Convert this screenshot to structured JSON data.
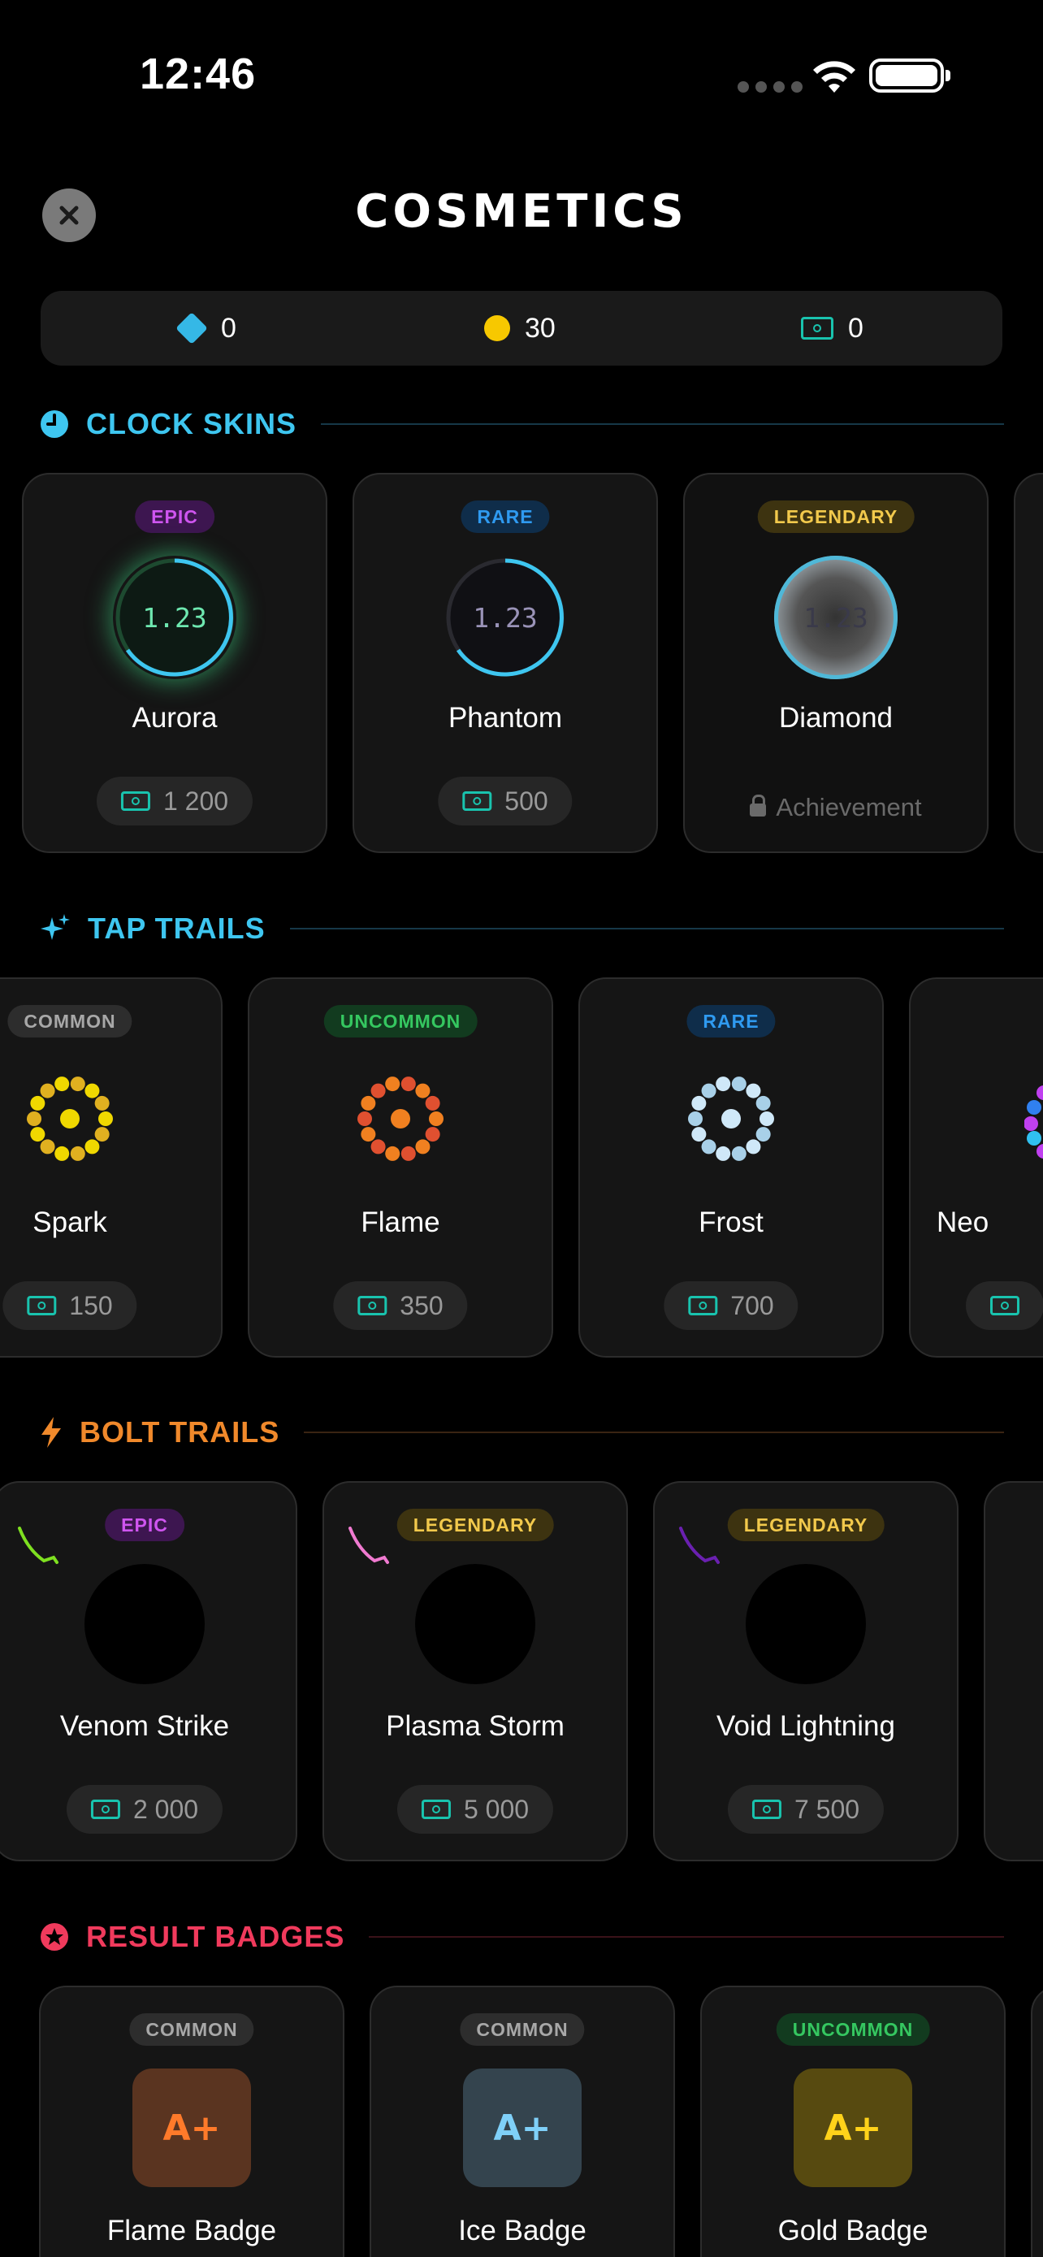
{
  "status": {
    "time": "12:46"
  },
  "title": "COSMETICS",
  "currency": {
    "gems": "0",
    "coins": "30",
    "tickets": "0"
  },
  "sections": {
    "clock_skins": "CLOCK SKINS",
    "tap_trails": "TAP TRAILS",
    "bolt_trails": "BOLT TRAILS",
    "result_badges": "RESULT BADGES"
  },
  "clock_skins": [
    {
      "rarity": "EPIC",
      "preview": "1.23",
      "name": "Aurora",
      "price": "1 200"
    },
    {
      "rarity": "RARE",
      "preview": "1.23",
      "name": "Phantom",
      "price": "500"
    },
    {
      "rarity": "LEGENDARY",
      "preview": "1.23",
      "name": "Diamond",
      "locked_label": "Achievement"
    }
  ],
  "tap_trails": [
    {
      "rarity": "COMMON",
      "name": "Spark",
      "price": "150",
      "colors": [
        "#e0b020",
        "#f0d800"
      ]
    },
    {
      "rarity": "UNCOMMON",
      "name": "Flame",
      "price": "350",
      "colors": [
        "#e05030",
        "#f08020"
      ]
    },
    {
      "rarity": "RARE",
      "name": "Frost",
      "price": "700",
      "colors": [
        "#a8d0e8",
        "#cfe8f8"
      ]
    },
    {
      "rarity": "",
      "name": "Neo",
      "price": ""
    }
  ],
  "bolt_trails": [
    {
      "rarity": "EPIC",
      "name": "Venom Strike",
      "price": "2 000",
      "color": "#7ee020"
    },
    {
      "rarity": "LEGENDARY",
      "name": "Plasma Storm",
      "price": "5 000",
      "color": "#f07ad0"
    },
    {
      "rarity": "LEGENDARY",
      "name": "Void Lightning",
      "price": "7 500",
      "color": "#6a20b0"
    }
  ],
  "result_badges": [
    {
      "rarity": "COMMON",
      "glyph": "A+",
      "name": "Flame Badge"
    },
    {
      "rarity": "COMMON",
      "glyph": "A+",
      "name": "Ice Badge"
    },
    {
      "rarity": "UNCOMMON",
      "glyph": "A+",
      "name": "Gold Badge"
    }
  ],
  "colors": {
    "clock": "#3ec6f0",
    "tap": "#3ec6f0",
    "bolt": "#f0892b",
    "badge": "#f03a5c"
  }
}
